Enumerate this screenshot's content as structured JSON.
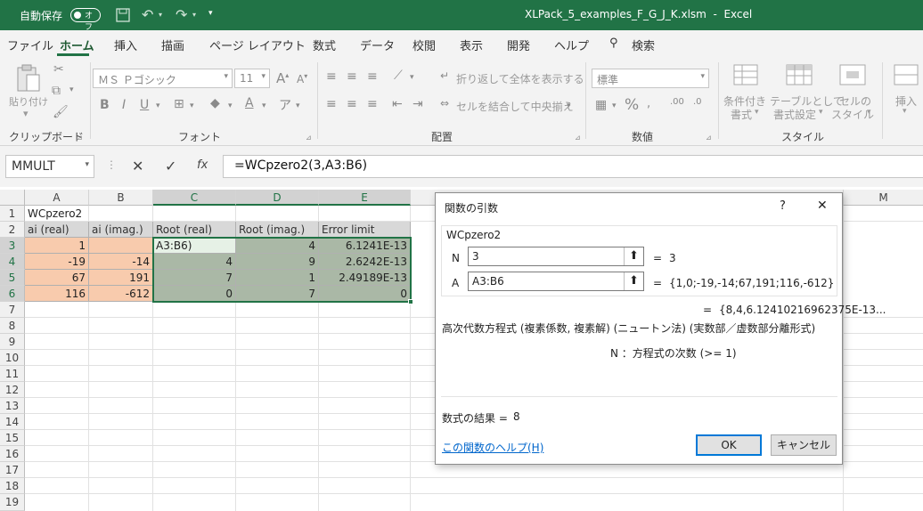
{
  "titlebar": {
    "autosave_label": "自動保存",
    "autosave_state": "オフ",
    "filename": "XLPack_5_examples_F_G_J_K.xlsm",
    "app": "Excel"
  },
  "tabs": [
    "ファイル",
    "ホーム",
    "挿入",
    "描画",
    "ページ レイアウト",
    "数式",
    "データ",
    "校閲",
    "表示",
    "開発",
    "ヘルプ",
    "検索"
  ],
  "ribbon": {
    "paste": "貼り付け",
    "clipboard": "クリップボード",
    "font_name": "ＭＳ Ｐゴシック",
    "font_size": "11",
    "font": "フォント",
    "bold": "B",
    "italic": "I",
    "underline": "U",
    "wrap": "折り返して全体を表示する",
    "merge": "セルを結合して中央揃え",
    "alignment": "配置",
    "number_format": "標準",
    "number": "数値",
    "cond_fmt_1": "条件付き",
    "cond_fmt_2": "書式",
    "table_fmt_1": "テーブルとして",
    "table_fmt_2": "書式設定",
    "cell_style_1": "セルの",
    "cell_style_2": "スタイル",
    "styles": "スタイル",
    "insert": "挿入"
  },
  "formula_bar": {
    "name_box": "MMULT",
    "fx": "fx",
    "formula": "=WCpzero2(3,A3:B6)"
  },
  "grid": {
    "columns": [
      "A",
      "B",
      "C",
      "D",
      "E",
      "M"
    ],
    "rows": [
      "1",
      "2",
      "3",
      "4",
      "5",
      "6",
      "7",
      "8",
      "9",
      "10",
      "11",
      "12",
      "13",
      "14",
      "15",
      "16",
      "17",
      "18",
      "19"
    ],
    "A1": "WCpzero2",
    "headers": [
      "ai (real)",
      "ai (imag.)",
      "Root (real)",
      "Root (imag.)",
      "Error limit"
    ],
    "data": [
      [
        "1",
        "",
        "A3:B6)",
        "4",
        "6.1241E-13"
      ],
      [
        "-19",
        "-14",
        "4",
        "9",
        "2.6242E-13"
      ],
      [
        "67",
        "191",
        "7",
        "1",
        "2.49189E-13"
      ],
      [
        "116",
        "-612",
        "0",
        "7",
        "0"
      ]
    ]
  },
  "dialog": {
    "title": "関数の引数",
    "help_q": "?",
    "close": "✕",
    "func_name": "WCpzero2",
    "arg1_label": "N",
    "arg1_value": "3",
    "arg1_result": "3",
    "arg2_label": "A",
    "arg2_value": "A3:B6",
    "arg2_result": "{1,0;-19,-14;67,191;116,-612}",
    "eq": "=",
    "result_preview": "{8,4,6.12410216962375E-13...",
    "description": "高次代数方程式 (複素係数, 複素解) (ニュートン法) (実数部／虚数部分離形式)",
    "arg_help": "N ：方程式の次数 (>= 1)",
    "result_label": "数式の結果 =",
    "result_value": "8",
    "help_link": "この関数のヘルプ(H)",
    "ok": "OK",
    "cancel": "キャンセル"
  }
}
